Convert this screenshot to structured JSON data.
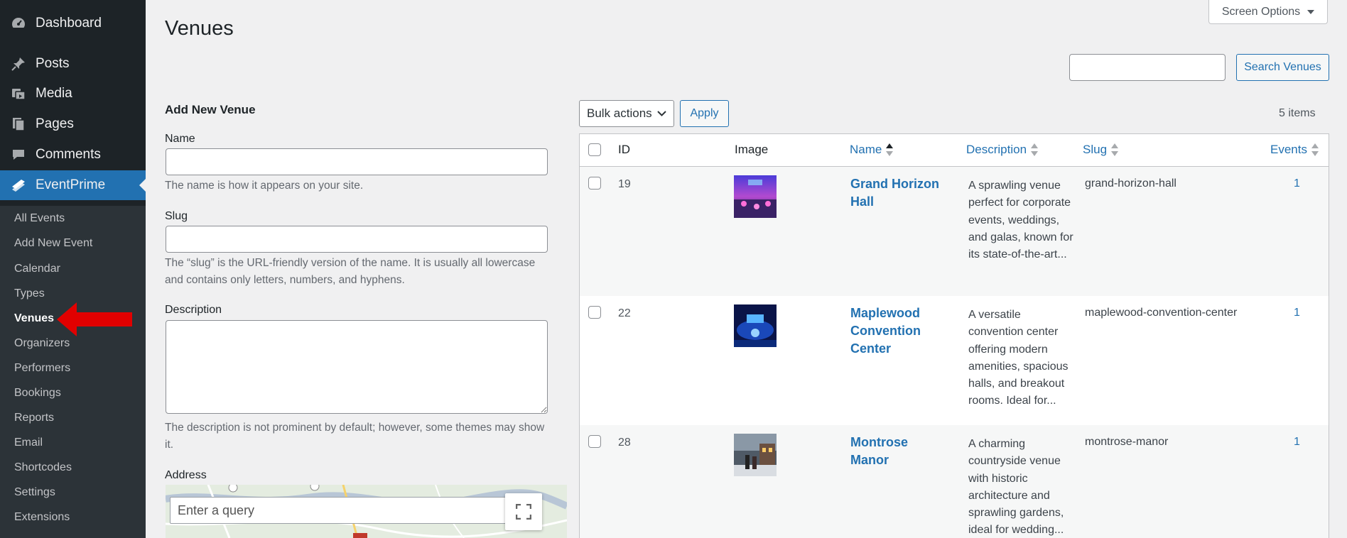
{
  "colors": {
    "sidebar_bg": "#1d2327",
    "submenu_bg": "#2c3338",
    "accent": "#2271b1",
    "arrow": "#e10000"
  },
  "sidebar": {
    "menu": [
      {
        "label": "Dashboard",
        "icon": "dashboard-icon"
      },
      {
        "label": "Posts",
        "icon": "pushpin-icon"
      },
      {
        "label": "Media",
        "icon": "media-icon"
      },
      {
        "label": "Pages",
        "icon": "pages-icon"
      },
      {
        "label": "Comments",
        "icon": "comment-icon"
      },
      {
        "label": "EventPrime",
        "icon": "eventprime-icon",
        "current": true
      }
    ],
    "submenu": [
      "All Events",
      "Add New Event",
      "Calendar",
      "Types",
      "Venues",
      "Organizers",
      "Performers",
      "Bookings",
      "Reports",
      "Email",
      "Shortcodes",
      "Settings",
      "Extensions"
    ],
    "current_submenu": "Venues"
  },
  "header": {
    "title": "Venues",
    "screen_options": "Screen Options"
  },
  "search": {
    "value": "",
    "button": "Search Venues"
  },
  "form": {
    "heading": "Add New Venue",
    "name_label": "Name",
    "name_help": "The name is how it appears on your site.",
    "slug_label": "Slug",
    "slug_help": "The “slug” is the URL-friendly version of the name. It is usually all lowercase and contains only letters, numbers, and hyphens.",
    "description_label": "Description",
    "description_help": "The description is not prominent by default; however, some themes may show it.",
    "address_label": "Address",
    "map_search_placeholder": "Enter a query"
  },
  "table": {
    "bulk_actions": "Bulk actions",
    "apply": "Apply",
    "items_count": "5 items",
    "columns": {
      "id": "ID",
      "image": "Image",
      "name": "Name",
      "description": "Description",
      "slug": "Slug",
      "events": "Events"
    },
    "rows": [
      {
        "id": "19",
        "name": "Grand Horizon Hall",
        "description": "A sprawling venue perfect for corporate events, weddings, and galas, known for its state-of-the-art...",
        "slug": "grand-horizon-hall",
        "events": "1"
      },
      {
        "id": "22",
        "name": "Maplewood Convention Center",
        "description": "A versatile convention center offering modern amenities, spacious halls, and breakout rooms. Ideal for...",
        "slug": "maplewood-convention-center",
        "events": "1"
      },
      {
        "id": "28",
        "name": "Montrose Manor",
        "description": "A charming countryside venue with historic architecture and sprawling gardens, ideal for wedding...",
        "slug": "montrose-manor",
        "events": "1"
      }
    ]
  }
}
